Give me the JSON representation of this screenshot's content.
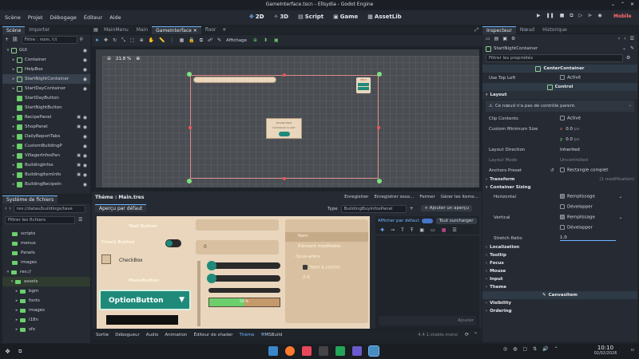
{
  "window_title": "GameInterface.tscn - Ellsydia - Godot Engine",
  "menu": [
    "Scène",
    "Projet",
    "Débogage",
    "Éditeur",
    "Aide"
  ],
  "workspaces": [
    "2D",
    "3D",
    "Script",
    "Game",
    "AssetLib"
  ],
  "renderer": "Mobile",
  "scene_dock": {
    "tabs": [
      "Scène",
      "Importer"
    ],
    "filter_placeholder": "Filtre : nom, t:t",
    "nodes": [
      "GUI",
      "Container",
      "HelpBox",
      "StartNightContainer",
      "StartDayContainer",
      "StartDayButton",
      "StartNightButton",
      "RecipePanel",
      "ShopPanel",
      "DailyReportTabs",
      "CustomBuildingP",
      "VillagerInfosPan",
      "BuildingInfos",
      "BuildingItemInfo",
      "BuildingRecipeIn"
    ]
  },
  "filesystem": {
    "title": "Système de fichiers",
    "path": "res://datas/buildings/tave",
    "filter_placeholder": "Filtrer les fichiers",
    "items": [
      "scripts",
      "menus",
      "Panels",
      "images",
      "res://",
      "assets",
      "bgm",
      "fonts",
      "images",
      "i18n",
      "sfx"
    ]
  },
  "editor_tabs": [
    "MainMenu",
    "Main",
    "GameInterface",
    "floor"
  ],
  "viewport": {
    "zoom": "21.8 %",
    "display_label": "Affichage",
    "popup_title": "Prompt Start",
    "popup_text": "Commencer la nuit?",
    "helpbox_label": "HELP"
  },
  "theme_editor": {
    "title": "Thème : Main.tres",
    "buttons": [
      "Enregistrer",
      "Enregistrer sous...",
      "Fermer",
      "Gérer les items..."
    ],
    "preview_tab": "Aperçu par défaut",
    "add_preview": "Ajouter un aperçu",
    "type_label": "Type",
    "type_value": "BuildingBuyInfosPanel",
    "show_default": "Afficher par défaut",
    "override_all": "Tout surcharger",
    "add_label": "Ajouter",
    "preview": {
      "top_label": "Text Button",
      "check_button": "Check Button",
      "check_box": "CheckBox",
      "menu_button": "MenuButton",
      "option_button": "OptionButton",
      "spin_value": "0",
      "progress": "50 %",
      "tree_items": [
        "Item",
        "Élément modifiable",
        "Sous-arbre",
        "Item à cocher"
      ],
      "tree_value": "2.0"
    }
  },
  "bottom_tabs": [
    "Sortie",
    "Débogueur",
    "Audio",
    "Animation",
    "Éditeur de shader",
    "Thème",
    "MSBuild"
  ],
  "version": "4.4.1.stable.mono",
  "inspector": {
    "tabs": [
      "Inspecteur",
      "Nœud",
      "Historique"
    ],
    "node_name": "StartNightContainer",
    "filter_placeholder": "Filtrer les propriétés",
    "class_header": "CenterContainer",
    "use_top_left_label": "Use Top Left",
    "use_top_left_value": "Activé",
    "control_header": "Control",
    "layout_cat": "Layout",
    "warning": "Ce nœud n'a pas de contrôle parent.",
    "clip_contents_label": "Clip Contents",
    "clip_contents_value": "Activé",
    "custom_min_size_label": "Custom Minimum Size",
    "min_x": "0.0",
    "min_y": "0.0",
    "unit": "px",
    "layout_direction_label": "Layout Direction",
    "layout_direction_value": "Inherited",
    "layout_mode_label": "Layout Mode",
    "layout_mode_value": "Uncontrolled",
    "anchors_preset_label": "Anchors Preset",
    "anchors_preset_value": "Rectangle complet",
    "transform_cat": "Transform",
    "transform_note": "(1 modification)",
    "container_sizing_cat": "Container Sizing",
    "horizontal_label": "Horizontal",
    "horizontal_value": "Remplissage",
    "expand_label": "Développer",
    "vertical_label": "Vertical",
    "vertical_value": "Remplissage",
    "stretch_ratio_label": "Stretch Ratio",
    "stretch_ratio_value": "1.0",
    "categories": [
      "Localization",
      "Tooltip",
      "Focus",
      "Mouse",
      "Input",
      "Theme"
    ],
    "canvasitem_header": "CanvasItem",
    "bottom_cats": [
      "Visibility",
      "Ordering"
    ]
  },
  "taskbar": {
    "time": "10:10",
    "date": "02/02/2026"
  },
  "colors": {
    "accent": "#6fb6ff",
    "node_green": "#6ccf6c",
    "option_teal": "#1f8a7a",
    "preview_bg": "#e9d6bd"
  }
}
